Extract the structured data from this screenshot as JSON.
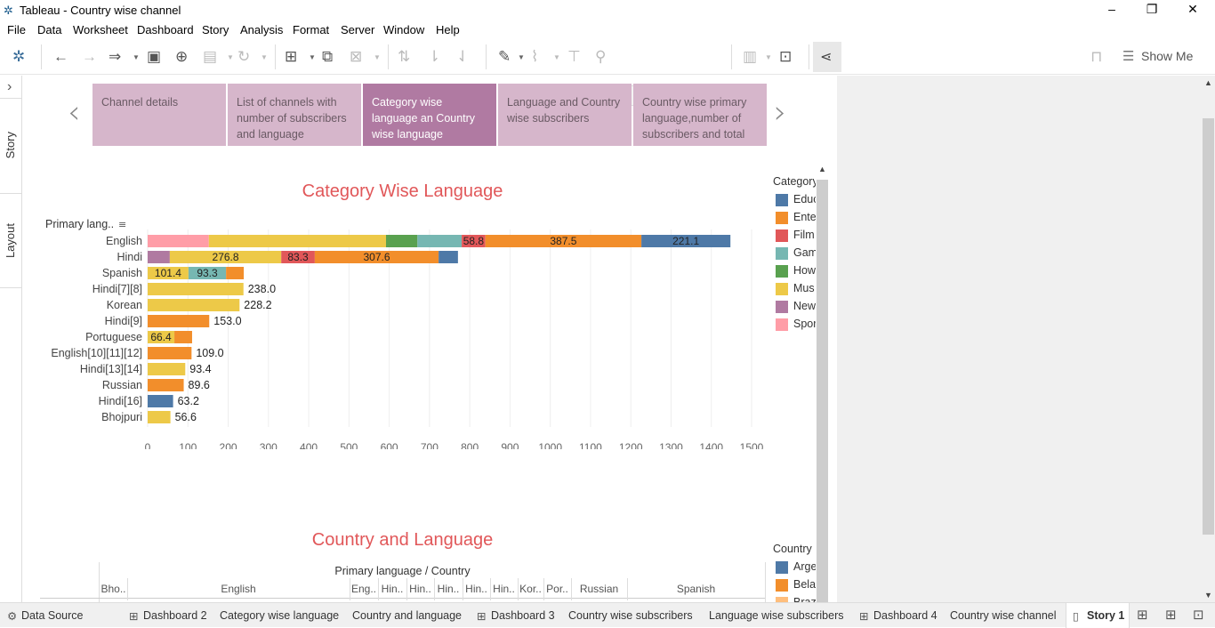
{
  "window": {
    "title": "Tableau - Country wise channel",
    "minimize": "–",
    "restore": "❐",
    "close": "✕"
  },
  "menu": [
    "File",
    "Data",
    "Worksheet",
    "Dashboard",
    "Story",
    "Analysis",
    "Format",
    "Server",
    "Window",
    "Help"
  ],
  "toolbar": {
    "show_me_label": "Show Me"
  },
  "left_panel": {
    "expand_icon": "›",
    "tabs": [
      "Story",
      "Layout"
    ]
  },
  "story": {
    "prev_icon": "‹",
    "next_icon": "›",
    "points": [
      {
        "label": "Channel details",
        "active": false
      },
      {
        "label": "List of channels with number of subscribers and language",
        "active": false
      },
      {
        "label": "Category wise language an Country wise language",
        "active": true
      },
      {
        "label": "Language and Country wise subscribers",
        "active": false
      },
      {
        "label": "Country wise primary language,number of subscribers and total",
        "active": false
      }
    ]
  },
  "dashboard": {
    "chart1_title": "Category Wise Language",
    "chart2_title": "Country and Language",
    "legend1": {
      "title": "Category",
      "items": [
        {
          "label": "Educ",
          "color": "#4e79a7"
        },
        {
          "label": "Ente",
          "color": "#f28e2b"
        },
        {
          "label": "Film",
          "color": "#e15759"
        },
        {
          "label": "Gam",
          "color": "#76b7b2"
        },
        {
          "label": "How",
          "color": "#59a14f"
        },
        {
          "label": "Mus",
          "color": "#edc948"
        },
        {
          "label": "New",
          "color": "#b07aa1"
        },
        {
          "label": "Spor",
          "color": "#ff9da7"
        }
      ]
    },
    "legend2": {
      "title": "Country",
      "items": [
        {
          "label": "Arge",
          "color": "#4e79a7"
        },
        {
          "label": "Bela",
          "color": "#f28e2b"
        },
        {
          "label": "Braz",
          "color": "#ffbe7d"
        }
      ]
    },
    "table2": {
      "header": "Primary language / Country",
      "columns": [
        "Bho..",
        "English",
        "Eng..",
        "Hin..",
        "Hin..",
        "Hin..",
        "Hin..",
        "Hin..",
        "Kor..",
        "Por..",
        "Russian",
        "Spanish"
      ]
    }
  },
  "chart_data": {
    "type": "bar",
    "orientation": "horizontal",
    "stacked": true,
    "title": "Category Wise Language",
    "ylabel": "Primary lang..",
    "xlabel": "",
    "xlim": [
      0,
      1500
    ],
    "xticks": [
      0,
      100,
      200,
      300,
      400,
      500,
      600,
      700,
      800,
      900,
      1000,
      1100,
      1200,
      1300,
      1400,
      1500
    ],
    "grid": true,
    "legend_position": "right",
    "categories": [
      "English",
      "Hindi",
      "Spanish",
      "Hindi[7][8]",
      "Korean",
      "Hindi[9]",
      "Portuguese",
      "English[10][11][12]",
      "Hindi[13][14]",
      "Russian",
      "Hindi[16]",
      "Bhojpuri"
    ],
    "colors": {
      "Sports": "#ff9da7",
      "News": "#b07aa1",
      "Music": "#edc948",
      "Howto": "#59a14f",
      "Gaming": "#76b7b2",
      "Film": "#e15759",
      "Entertainment": "#f28e2b",
      "Education": "#4e79a7"
    },
    "rows": [
      {
        "category": "English",
        "segments": [
          {
            "series": "Sports",
            "value": 152
          },
          {
            "series": "Music",
            "value": 440
          },
          {
            "series": "Howto",
            "value": 78
          },
          {
            "series": "Gaming",
            "value": 110
          },
          {
            "series": "Film",
            "value": 58.8,
            "label": "58.8"
          },
          {
            "series": "Entertainment",
            "value": 387.5,
            "label": "387.5"
          },
          {
            "series": "Education",
            "value": 221.1,
            "label": "221.1"
          }
        ]
      },
      {
        "category": "Hindi",
        "segments": [
          {
            "series": "News",
            "value": 55
          },
          {
            "series": "Music",
            "value": 276.8,
            "label": "276.8"
          },
          {
            "series": "Film",
            "value": 83.3,
            "label": "83.3"
          },
          {
            "series": "Entertainment",
            "value": 307.6,
            "label": "307.6"
          },
          {
            "series": "Education",
            "value": 48
          }
        ]
      },
      {
        "category": "Spanish",
        "segments": [
          {
            "series": "Music",
            "value": 101.4,
            "label": "101.4"
          },
          {
            "series": "Gaming",
            "value": 93.3,
            "label": "93.3"
          },
          {
            "series": "Entertainment",
            "value": 44
          }
        ]
      },
      {
        "category": "Hindi[7][8]",
        "total_label": "238.0",
        "segments": [
          {
            "series": "Music",
            "value": 238.0
          }
        ]
      },
      {
        "category": "Korean",
        "total_label": "228.2",
        "segments": [
          {
            "series": "Music",
            "value": 228.2
          }
        ]
      },
      {
        "category": "Hindi[9]",
        "total_label": "153.0",
        "segments": [
          {
            "series": "Entertainment",
            "value": 153.0
          }
        ]
      },
      {
        "category": "Portuguese",
        "segments": [
          {
            "series": "Music",
            "value": 66.4,
            "label": "66.4"
          },
          {
            "series": "Entertainment",
            "value": 44
          }
        ]
      },
      {
        "category": "English[10][11][12]",
        "total_label": "109.0",
        "segments": [
          {
            "series": "Entertainment",
            "value": 109.0
          }
        ]
      },
      {
        "category": "Hindi[13][14]",
        "total_label": "93.4",
        "segments": [
          {
            "series": "Music",
            "value": 93.4
          }
        ]
      },
      {
        "category": "Russian",
        "total_label": "89.6",
        "segments": [
          {
            "series": "Entertainment",
            "value": 89.6
          }
        ]
      },
      {
        "category": "Hindi[16]",
        "total_label": "63.2",
        "segments": [
          {
            "series": "Education",
            "value": 63.2
          }
        ]
      },
      {
        "category": "Bhojpuri",
        "total_label": "56.6",
        "segments": [
          {
            "series": "Music",
            "value": 56.6
          }
        ]
      }
    ]
  },
  "bottom_tabs": [
    {
      "label": "Data Source",
      "icon": "⚙"
    },
    {
      "label": "Dashboard 2",
      "icon": "⊞"
    },
    {
      "label": "Category wise language",
      "icon": ""
    },
    {
      "label": "Country and language",
      "icon": ""
    },
    {
      "label": "Dashboard 3",
      "icon": "⊞"
    },
    {
      "label": "Country wise subscribers",
      "icon": ""
    },
    {
      "label": "Language wise subscribers",
      "icon": ""
    },
    {
      "label": "Dashboard 4",
      "icon": "⊞"
    },
    {
      "label": "Country wise channel",
      "icon": ""
    },
    {
      "label": "Story 1",
      "icon": "▯",
      "active": true
    }
  ]
}
